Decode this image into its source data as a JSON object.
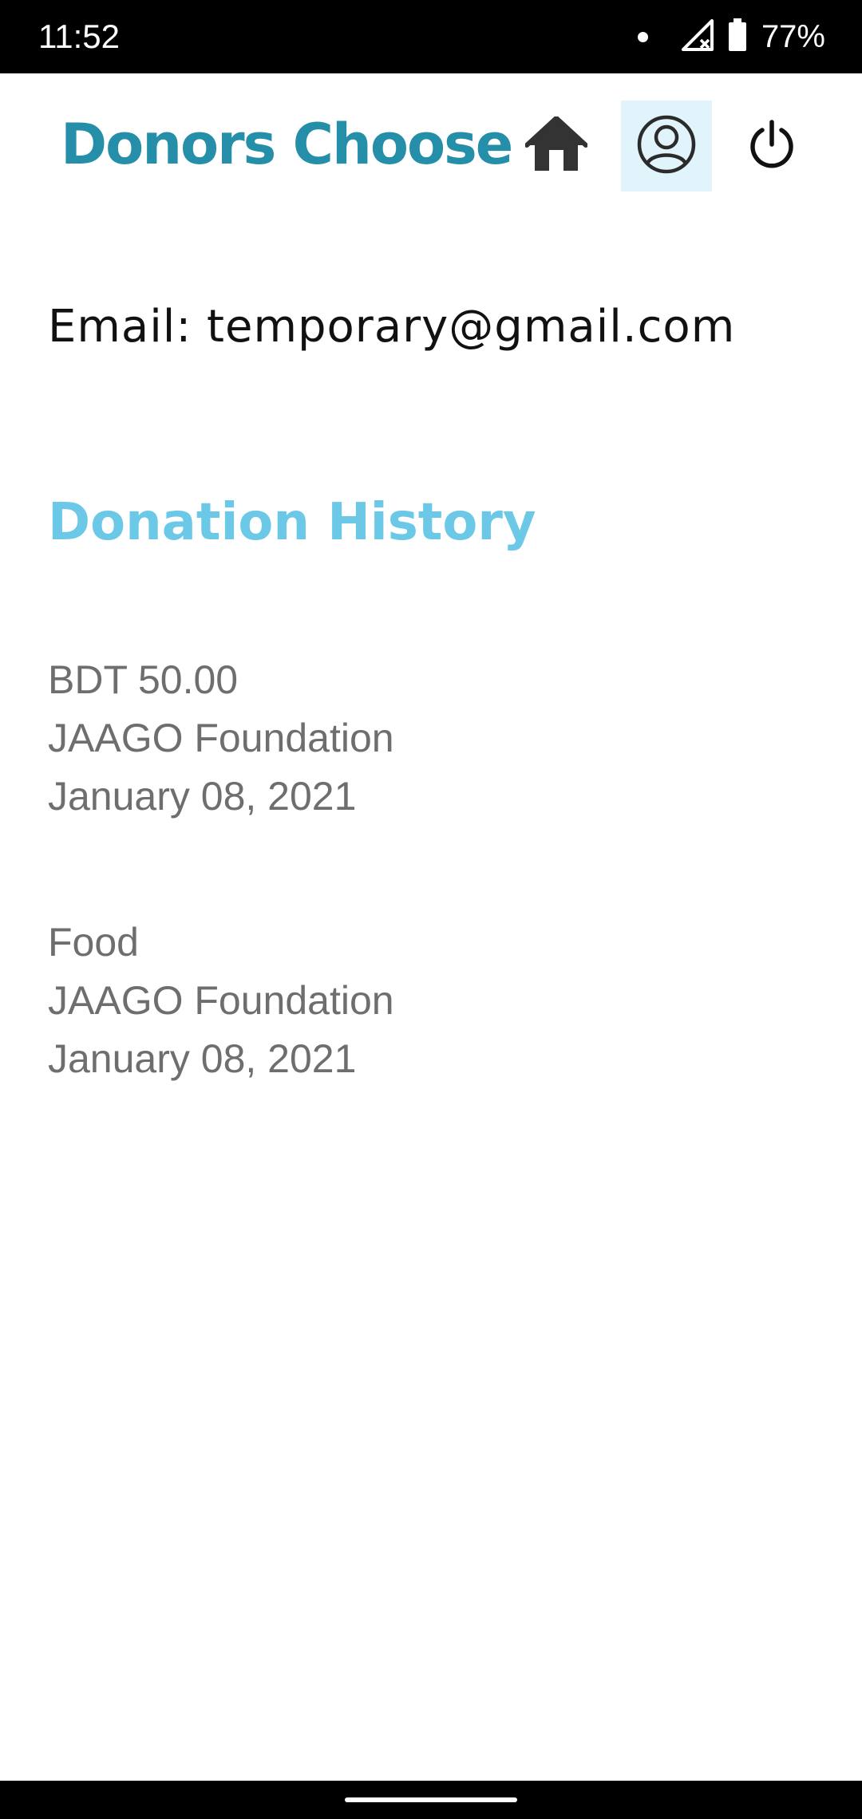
{
  "status_bar": {
    "time": "11:52",
    "battery": "77%",
    "icons": [
      "notification-dot-icon",
      "signal-no-service-icon",
      "battery-icon"
    ]
  },
  "app_bar": {
    "title": "Donors Choose",
    "title_color": "#258ea8",
    "actions": [
      {
        "name": "home",
        "icon": "home-icon"
      },
      {
        "name": "profile",
        "icon": "account-circle-icon",
        "selected": true,
        "selected_bg": "#e2f4fb"
      },
      {
        "name": "logout",
        "icon": "power-icon"
      }
    ]
  },
  "profile": {
    "email_line": "Email: temporary@gmail.com"
  },
  "donation_history": {
    "heading": "Donation History",
    "heading_color": "#6bc8e6",
    "items": [
      {
        "amount": "BDT 50.00",
        "organization": "JAAGO Foundation",
        "date": "January 08, 2021"
      },
      {
        "amount": "Food",
        "organization": "JAAGO Foundation",
        "date": "January 08, 2021"
      }
    ]
  }
}
